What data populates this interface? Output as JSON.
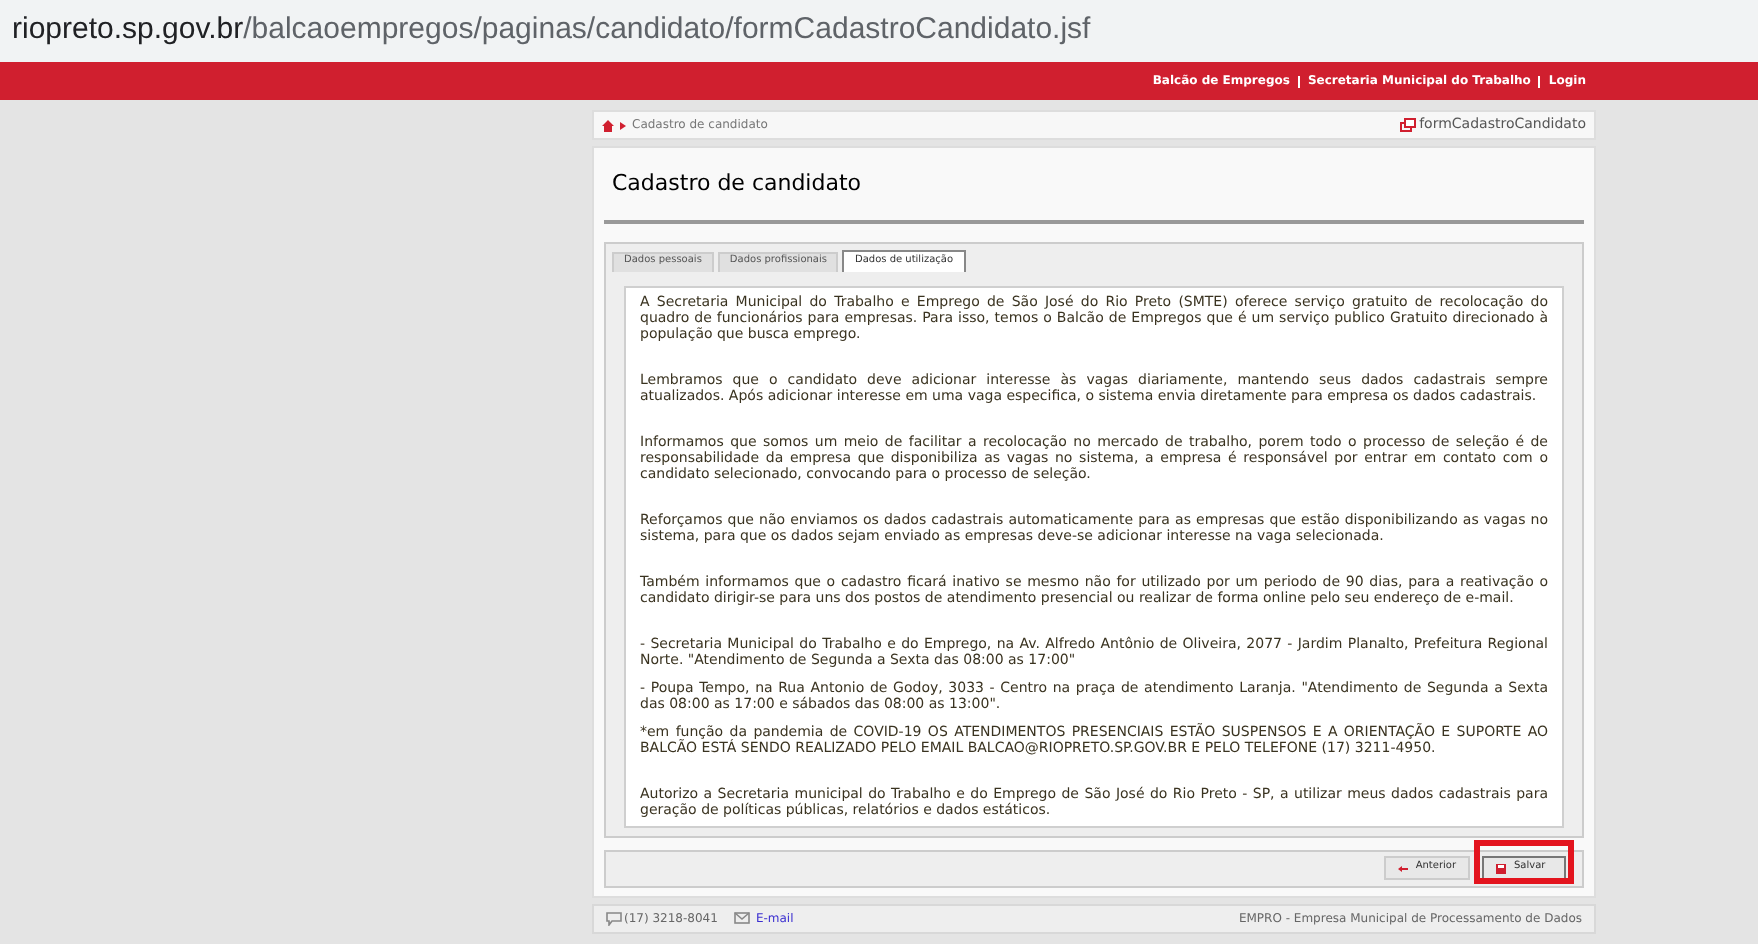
{
  "address_bar": {
    "host": "riopreto.sp.gov.br",
    "path": "/balcaoempregos/paginas/candidato/formCadastroCandidato.jsf"
  },
  "top_links": [
    "Balcão de Empregos",
    "Secretaria Municipal do Trabalho",
    "Login"
  ],
  "breadcrumb": {
    "current": "Cadastro de candidato",
    "page_id": "formCadastroCandidato"
  },
  "title": "Cadastro de candidato",
  "tabs": [
    {
      "label": "Dados pessoais",
      "selected": false
    },
    {
      "label": "Dados profissionais",
      "selected": false
    },
    {
      "label": "Dados de utilização",
      "selected": true
    }
  ],
  "paragraphs": [
    {
      "kind": "paragraph",
      "text": "A Secretaria Municipal do Trabalho e Emprego de São José do Rio Preto (SMTE) oferece serviço gratuito de recolocação do quadro de funcionários para empresas. Para isso, temos o Balcão de Empregos que é um serviço publico Gratuito direcionado à população que busca emprego."
    },
    {
      "kind": "paragraph",
      "text": "Lembramos que o candidato deve adicionar interesse às vagas diariamente, mantendo seus dados cadastrais sempre atualizados. Após adicionar interesse em uma vaga especifica, o sistema envia diretamente para empresa os dados cadastrais."
    },
    {
      "kind": "paragraph",
      "text": "Informamos que somos um meio de facilitar a recolocação no mercado de trabalho, porem todo o processo de seleção é de responsabilidade da empresa que disponibiliza as vagas no sistema, a empresa é responsável por entrar em contato com o candidato selecionado, convocando para o processo de seleção."
    },
    {
      "kind": "paragraph",
      "text": "Reforçamos que não enviamos os dados cadastrais automaticamente para as empresas que estão disponibilizando as vagas no sistema, para que os dados sejam enviado as empresas deve-se adicionar interesse na vaga selecionada."
    },
    {
      "kind": "paragraph",
      "text": "Também informamos que o cadastro ficará inativo se mesmo não for utilizado por um periodo de 90 dias, para a reativação o candidato dirigir-se para uns dos postos de atendimento presencial ou realizar de forma online pelo seu endereço de e-mail."
    },
    {
      "kind": "paragraph",
      "text": "- Secretaria Municipal do Trabalho e do Emprego, na Av. Alfredo Antônio de Oliveira, 2077 - Jardim Planalto, Prefeitura Regional Norte. \"Atendimento de Segunda a Sexta das 08:00 as 17:00\""
    },
    {
      "kind": "item",
      "text": "- Poupa Tempo, na Rua Antonio de Godoy, 3033 - Centro na praça de atendimento Laranja. \"Atendimento de Segunda a Sexta das 08:00 as 17:00 e sábados das 08:00 as 13:00\"."
    },
    {
      "kind": "item",
      "text": "*em função da pandemia de COVID-19 OS ATENDIMENTOS PRESENCIAIS ESTÃO SUSPENSOS E A ORIENTAÇÃO E SUPORTE AO BALCÃO ESTÁ SENDO REALIZADO PELO EMAIL BALCAO@RIOPRETO.SP.GOV.BR E PELO TELEFONE (17) 3211-4950."
    },
    {
      "kind": "paragraph",
      "text": "Autorizo a Secretaria municipal do Trabalho e do Emprego de São José do Rio Preto - SP, a utilizar meus dados cadastrais para geração de políticas públicas, relatórios e dados estáticos."
    }
  ],
  "buttons": [
    {
      "kind": "previous",
      "label": "Anterior",
      "highlighted": false
    },
    {
      "kind": "save",
      "label": "Salvar",
      "highlighted": true
    }
  ],
  "footer": {
    "phone": "(17) 3218-8041",
    "email": "E-mail",
    "credit": "EMPRO - Empresa Municipal de Processamento de Dados"
  }
}
